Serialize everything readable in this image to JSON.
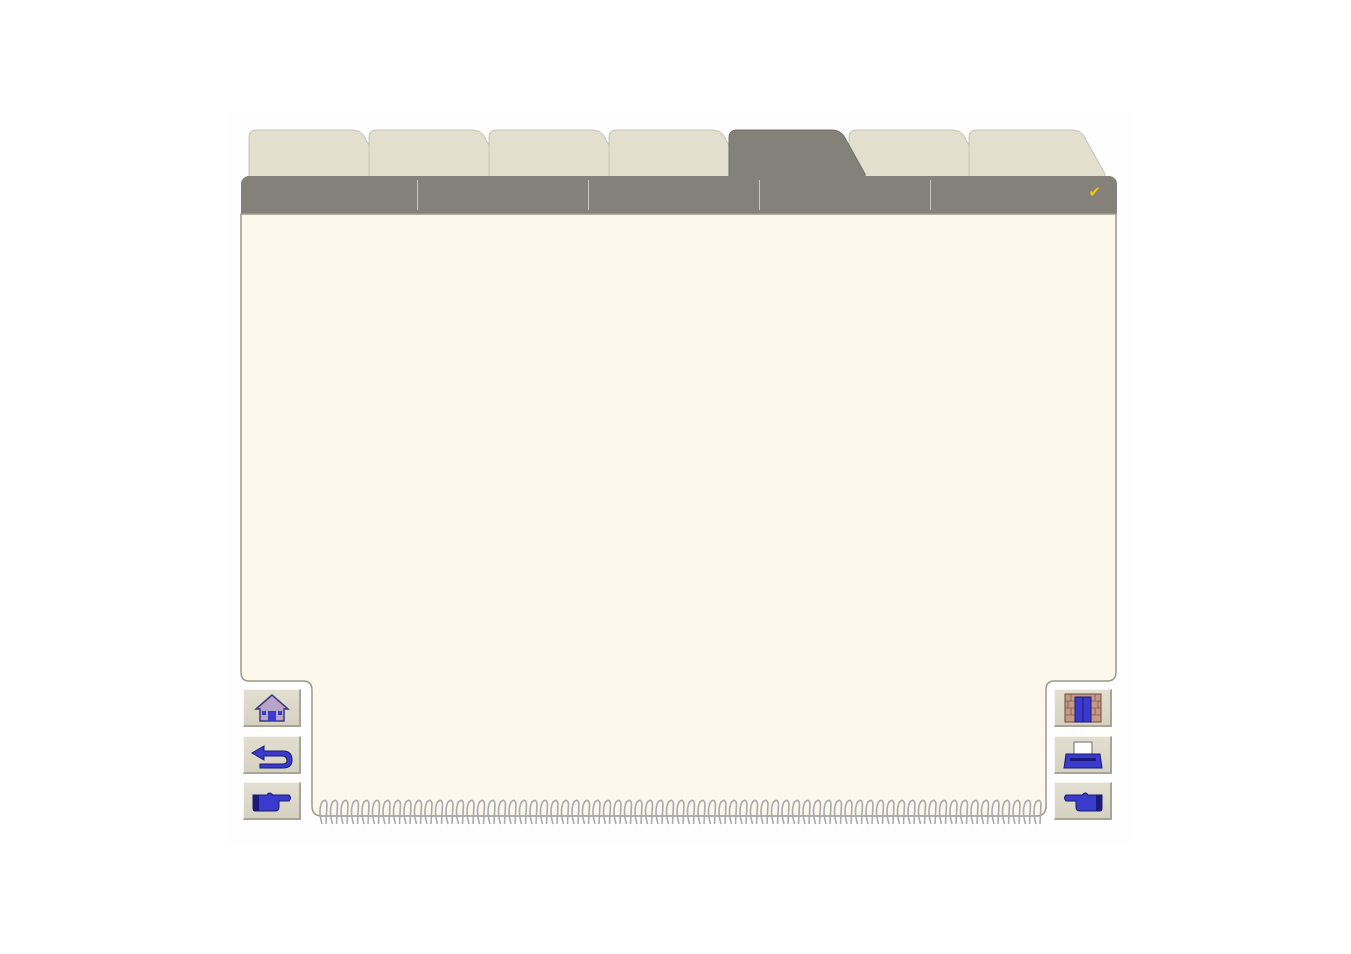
{
  "tabs": [
    {
      "id": "tab-1",
      "label": "",
      "active": false
    },
    {
      "id": "tab-2",
      "label": "",
      "active": false
    },
    {
      "id": "tab-3",
      "label": "",
      "active": false
    },
    {
      "id": "tab-4",
      "label": "",
      "active": false
    },
    {
      "id": "tab-5",
      "label": "",
      "active": true
    },
    {
      "id": "tab-6",
      "label": "",
      "active": false
    },
    {
      "id": "tab-7",
      "label": "",
      "active": false
    }
  ],
  "subtabs": [
    "",
    "",
    "",
    "",
    ""
  ],
  "subtab_marker": "✔",
  "colors": {
    "tab_inactive": "#e3dfcf",
    "tab_active": "#83817a",
    "page": "#fdf7ec",
    "button_face": "#dcd8c8",
    "icon_blue": "#3a3acc",
    "check": "#f2c20c"
  },
  "nav_left": {
    "home_icon": "home-icon",
    "back_icon": "back-arrow-icon",
    "next_icon": "pointing-hand-icon"
  },
  "nav_right": {
    "exit_icon": "exit-door-icon",
    "print_icon": "printer-icon",
    "prev_icon": "pointing-hand-left-icon"
  }
}
